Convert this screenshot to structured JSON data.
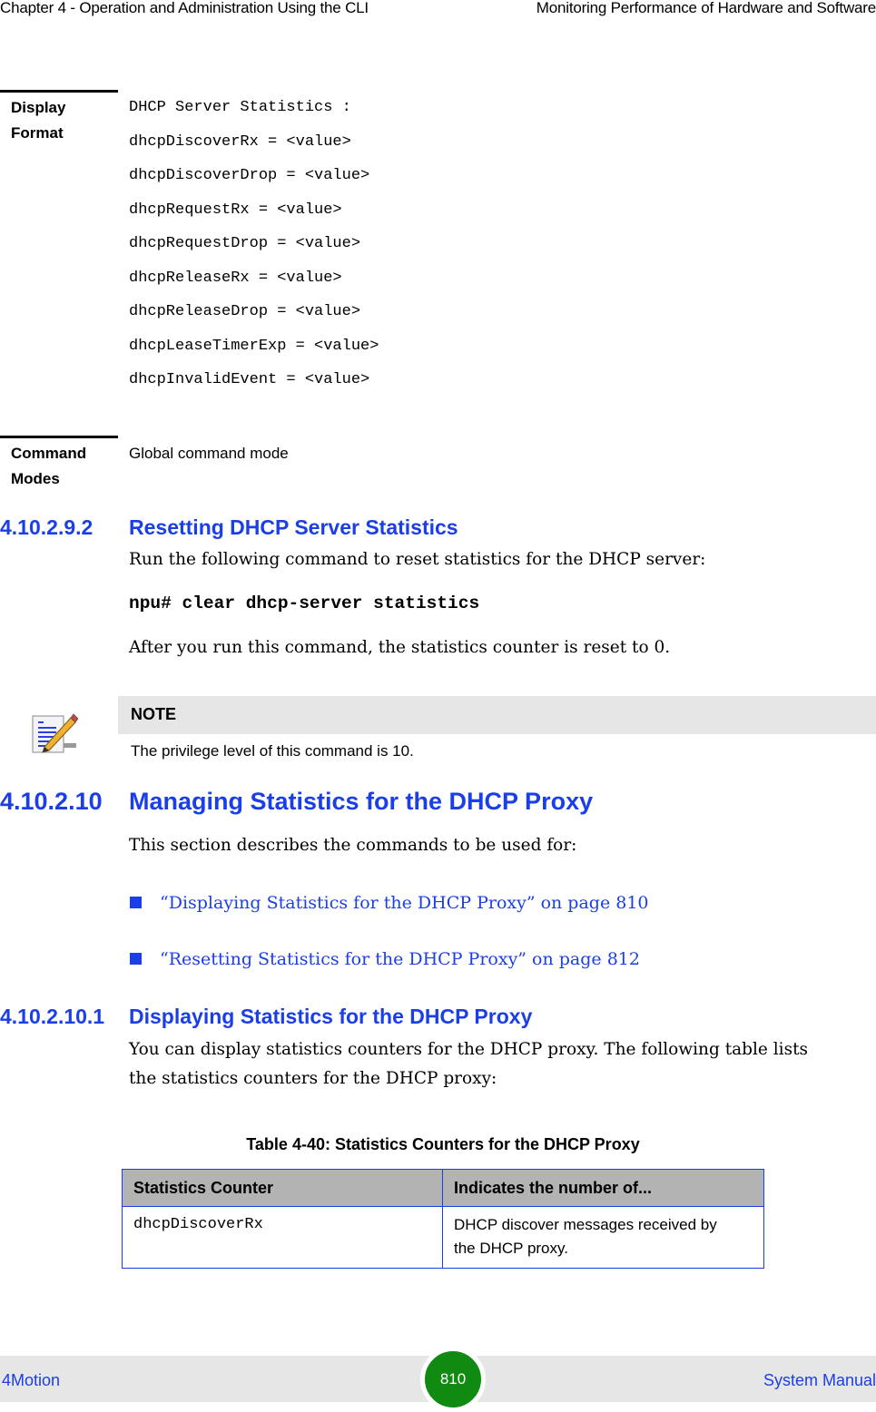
{
  "header": {
    "chapter": "Chapter 4 - Operation and Administration Using the CLI",
    "section": "Monitoring Performance of Hardware and Software"
  },
  "display_format": {
    "label_line1": "Display",
    "label_line2": "Format",
    "lines": [
      "DHCP Server Statistics :",
      "dhcpDiscoverRx = <value>",
      "dhcpDiscoverDrop = <value>",
      "dhcpRequestRx = <value>",
      "dhcpRequestDrop = <value>",
      "dhcpReleaseRx = <value>",
      "dhcpReleaseDrop = <value>",
      "dhcpLeaseTimerExp = <value>",
      "dhcpInvalidEvent = <value>"
    ]
  },
  "command_modes": {
    "label_line1": "Command",
    "label_line2": "Modes",
    "value": "Global command mode"
  },
  "section_9_2": {
    "number": "4.10.2.9.2",
    "title": "Resetting DHCP Server Statistics",
    "intro": "Run the following command to reset statistics for the DHCP server:",
    "command": "npu# clear dhcp-server statistics",
    "after": "After you run this command, the statistics counter is reset to 0."
  },
  "note": {
    "icon": "note-pencil-icon",
    "title": "NOTE",
    "text": "The privilege level of this command is 10."
  },
  "section_10": {
    "number": "4.10.2.10",
    "title": "Managing Statistics for the DHCP Proxy",
    "intro": "This section describes the commands to be used for:",
    "links": [
      "“Displaying Statistics for the DHCP Proxy” on page 810",
      "“Resetting Statistics for the DHCP Proxy” on page 812"
    ]
  },
  "section_10_1": {
    "number": "4.10.2.10.1",
    "title": "Displaying Statistics for the DHCP Proxy",
    "body_line1": "You can display statistics counters for the DHCP proxy. The following table lists",
    "body_line2": "the statistics counters for the DHCP proxy:"
  },
  "table": {
    "caption": "Table 4-40: Statistics Counters for the DHCP Proxy",
    "headers": [
      "Statistics Counter",
      "Indicates the number of..."
    ],
    "rows": [
      {
        "counter": "dhcpDiscoverRx",
        "description_line1": "DHCP discover messages received by",
        "description_line2": "the DHCP proxy."
      }
    ]
  },
  "footer": {
    "left": "4Motion",
    "page": "810",
    "right": "System Manual"
  },
  "colors": {
    "heading_blue": "#1a3ee8",
    "page_badge_green": "#118a11",
    "note_bar_gray": "#e6e6e6",
    "table_header_gray": "#b3b3b3"
  }
}
